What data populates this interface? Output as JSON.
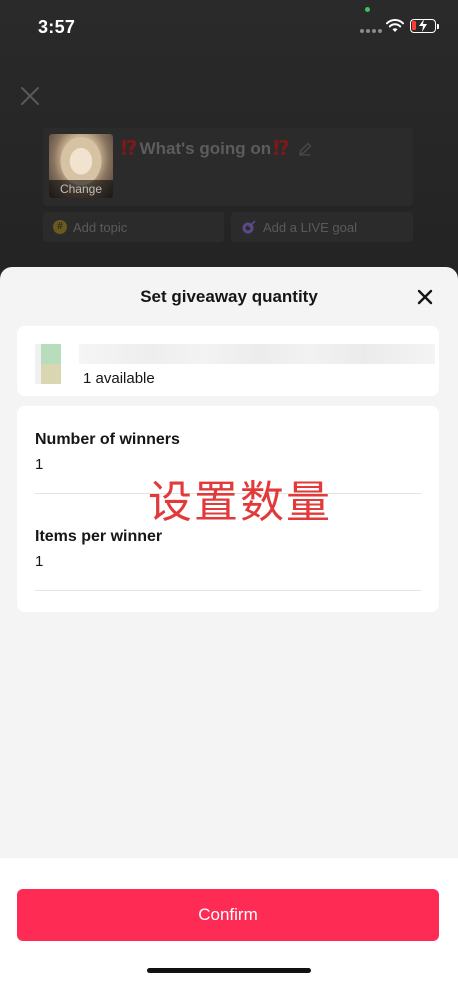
{
  "status_bar": {
    "time": "3:57"
  },
  "background": {
    "live_title": "What's going on",
    "title_marks": "⁉",
    "cover_change_label": "Change",
    "add_topic_label": "Add topic",
    "add_topic_icon": "hashtag-icon",
    "add_goal_label": "Add a LIVE goal",
    "add_goal_icon": "goal-icon"
  },
  "sheet": {
    "title": "Set giveaway quantity",
    "item": {
      "available_text": "1 available"
    },
    "fields": [
      {
        "label": "Number of winners",
        "value": "1"
      },
      {
        "label": "Items per winner",
        "value": "1"
      }
    ],
    "annotation": "设置数量",
    "confirm_label": "Confirm"
  },
  "colors": {
    "accent": "#fe2c55",
    "annotation": "#e23a3a",
    "sheet_bg": "#f4f4f4",
    "backdrop": "#1e1e1e"
  }
}
